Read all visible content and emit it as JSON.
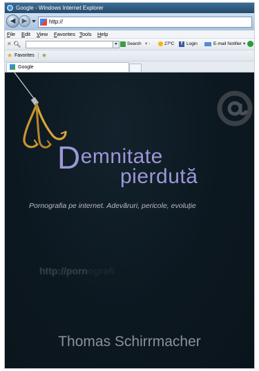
{
  "window": {
    "title": "Google - Windows Internet Explorer",
    "address": "http://"
  },
  "menu": {
    "items": [
      {
        "accel": "F",
        "rest": "ile"
      },
      {
        "accel": "E",
        "rest": "dit"
      },
      {
        "accel": "V",
        "rest": "iew"
      },
      {
        "accel": "F",
        "rest": "avorites"
      },
      {
        "accel": "T",
        "rest": "ools"
      },
      {
        "accel": "H",
        "rest": "elp"
      }
    ]
  },
  "toolbar": {
    "search_label": "Search",
    "weather": "27ºC",
    "login_label": "Login",
    "email_label": "E-mail Notifier"
  },
  "favorites": {
    "label": "Favorites"
  },
  "tabs": [
    {
      "label": "Google"
    }
  ],
  "page": {
    "title_first_letter": "D",
    "title_line1_rest": "emnitate",
    "title_line2": "pierdută",
    "subtitle": "Pornografia pe internet. Adevăruri, pericole, evoluție",
    "ghost_url_visible": "http://porn",
    "ghost_url_faded": "ografi",
    "author": "Thomas Schirrmacher"
  },
  "colors": {
    "cover_background": "#0c1820",
    "title_text": "#9b98d8",
    "hook": "#c9962e",
    "author_text": "#8c9199"
  }
}
